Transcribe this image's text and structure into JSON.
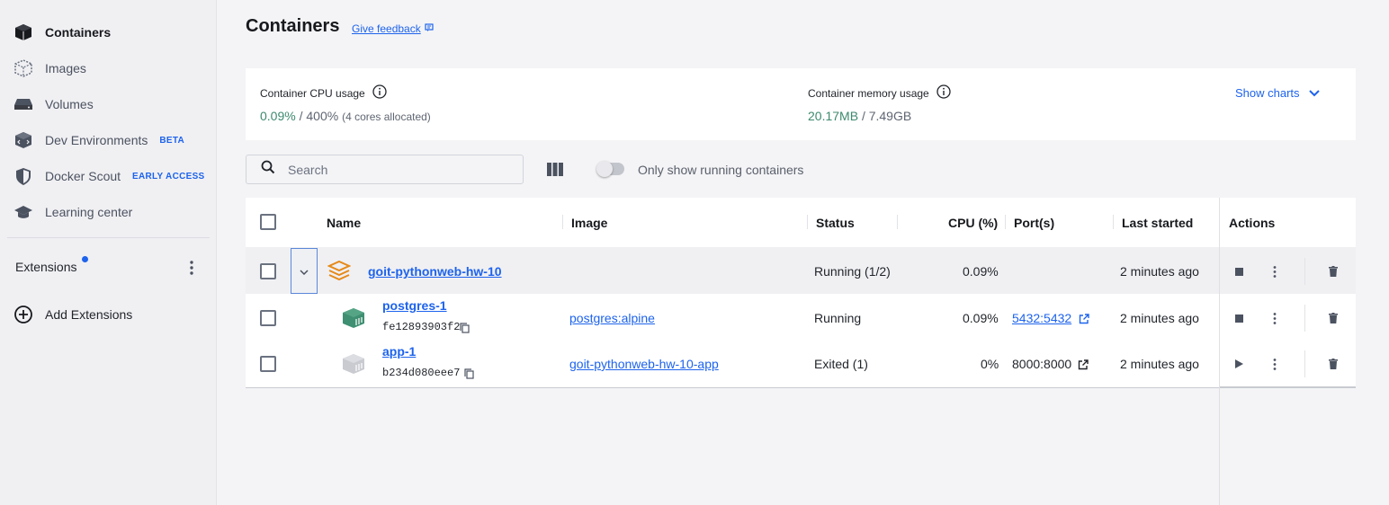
{
  "sidebar": {
    "items": [
      {
        "label": "Containers",
        "icon": "container-icon",
        "active": true
      },
      {
        "label": "Images",
        "icon": "image-icon"
      },
      {
        "label": "Volumes",
        "icon": "volume-icon"
      },
      {
        "label": "Dev Environments",
        "icon": "dev-env-icon",
        "badge": "BETA"
      },
      {
        "label": "Docker Scout",
        "icon": "shield-icon",
        "badge": "EARLY ACCESS"
      },
      {
        "label": "Learning center",
        "icon": "graduation-cap-icon"
      }
    ],
    "extensions_label": "Extensions",
    "add_extensions_label": "Add Extensions"
  },
  "header": {
    "title": "Containers",
    "feedback": "Give feedback"
  },
  "stats": {
    "cpu_label": "Container CPU usage",
    "cpu_used": "0.09%",
    "cpu_total": "/ 400%",
    "cpu_note": "(4 cores allocated)",
    "mem_label": "Container memory usage",
    "mem_used": "20.17MB",
    "mem_total": "/ 7.49GB",
    "show_charts": "Show charts"
  },
  "toolbar": {
    "search_placeholder": "Search",
    "toggle_label": "Only show running containers",
    "toggle_on": false
  },
  "table": {
    "columns": {
      "name": "Name",
      "image": "Image",
      "status": "Status",
      "cpu": "CPU (%)",
      "ports": "Port(s)",
      "last_started": "Last started",
      "actions": "Actions"
    },
    "group": {
      "name": "goit-pythonweb-hw-10",
      "status": "Running (1/2)",
      "cpu": "0.09%",
      "last_started": "2 minutes ago"
    },
    "rows": [
      {
        "name": "postgres-1",
        "id": "fe12893903f2",
        "image": "postgres:alpine",
        "status": "Running",
        "cpu": "0.09%",
        "ports": "5432:5432",
        "last_started": "2 minutes ago",
        "running": true
      },
      {
        "name": "app-1",
        "id": "b234d080eee7",
        "image": "goit-pythonweb-hw-10-app",
        "status": "Exited (1)",
        "cpu": "0%",
        "ports": "8000:8000",
        "last_started": "2 minutes ago",
        "running": false
      }
    ]
  },
  "colors": {
    "accent": "#1d63ed",
    "green": "#3d8a6e",
    "compose_orange": "#e68a1a",
    "running_container": "#3f8f72",
    "stopped_container": "#c9cbd1"
  }
}
